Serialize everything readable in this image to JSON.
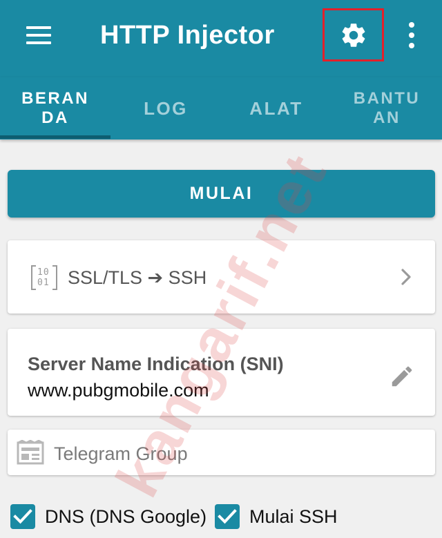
{
  "app_bar": {
    "title": "HTTP Injector",
    "menu_icon": "hamburger-menu-icon",
    "settings_icon": "gear-icon",
    "overflow_icon": "vertical-dots-icon",
    "highlight_color": "#e3202a",
    "background_color": "#1a8aa3"
  },
  "tabs": [
    {
      "label": "BERANDA",
      "active": true
    },
    {
      "label": "LOG",
      "active": false
    },
    {
      "label": "ALAT",
      "active": false
    },
    {
      "label": "BANTUAN",
      "active": false
    }
  ],
  "start_button": {
    "label": "MULAI"
  },
  "tunnel_mode": {
    "icon": "binary-code-icon",
    "label": "SSL/TLS ➔ SSH",
    "chevron_icon": "chevron-right-icon"
  },
  "sni": {
    "title": "Server Name Indication (SNI)",
    "value": "www.pubgmobile.com",
    "edit_icon": "pencil-icon"
  },
  "telegram": {
    "icon": "newspaper-icon",
    "label": "Telegram Group"
  },
  "options": [
    {
      "label": "DNS (DNS Google)",
      "checked": true
    },
    {
      "label": "Mulai SSH",
      "checked": true
    }
  ],
  "watermark": {
    "text": "kangarif.net"
  }
}
